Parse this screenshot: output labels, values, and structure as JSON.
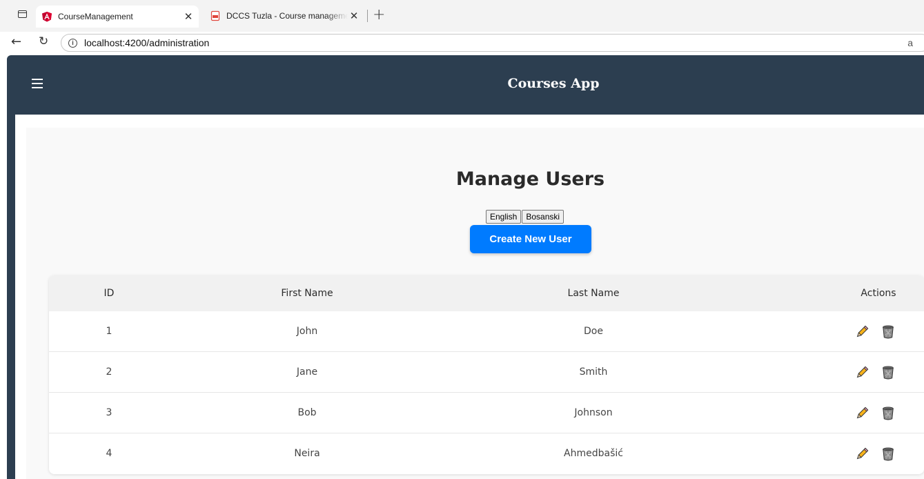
{
  "browser": {
    "tabs": [
      {
        "title": "CourseManagement",
        "active": true
      },
      {
        "title": "DCCS Tuzla - Course managemen",
        "active": false
      }
    ],
    "address": "localhost:4200/administration",
    "address_trailing": "a"
  },
  "app": {
    "title": "Courses App",
    "header_color": "#2c3e50"
  },
  "page": {
    "title": "Manage Users",
    "languages": [
      "English",
      "Bosanski"
    ],
    "create_button": "Create New User",
    "accent_color": "#007bff"
  },
  "table": {
    "columns": [
      "ID",
      "First Name",
      "Last Name",
      "Actions"
    ],
    "rows": [
      {
        "id": "1",
        "first_name": "John",
        "last_name": "Doe"
      },
      {
        "id": "2",
        "first_name": "Jane",
        "last_name": "Smith"
      },
      {
        "id": "3",
        "first_name": "Bob",
        "last_name": "Johnson"
      },
      {
        "id": "4",
        "first_name": "Neira",
        "last_name": "Ahmedbašić"
      }
    ],
    "row_actions": [
      "pencil-icon",
      "wastebasket-icon"
    ]
  }
}
